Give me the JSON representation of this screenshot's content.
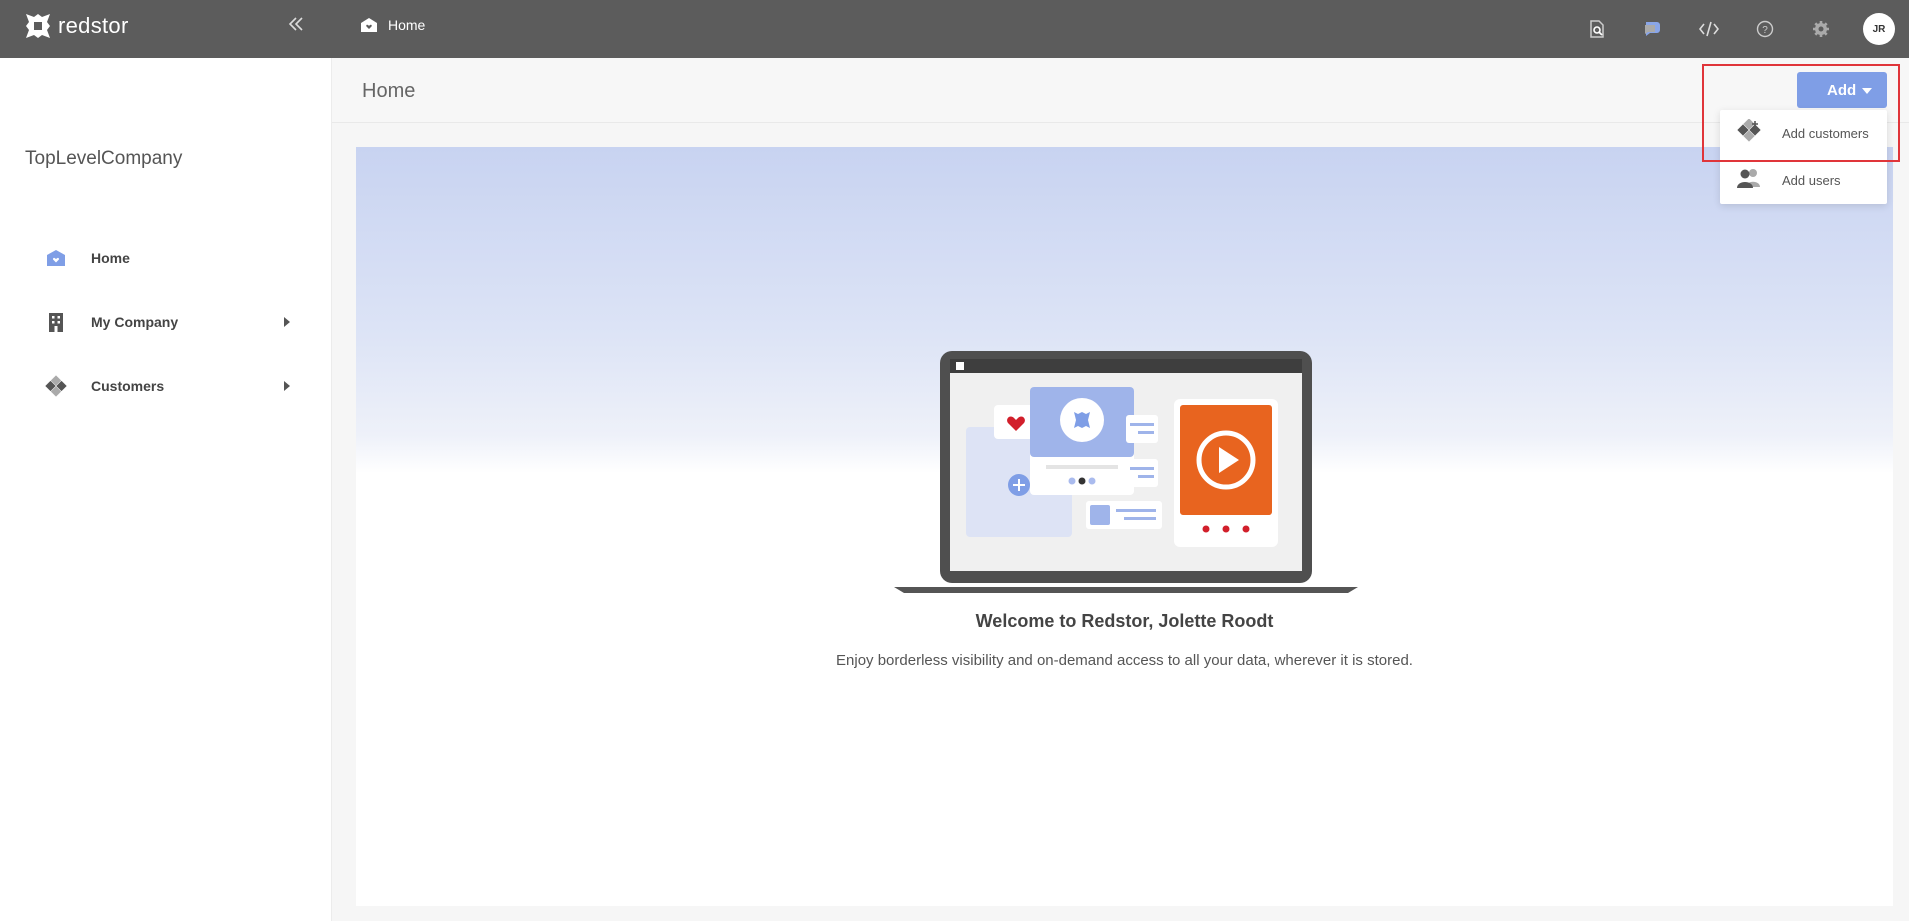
{
  "app": {
    "logo_text": "redstor"
  },
  "topbar": {
    "breadcrumb": "Home",
    "icons": [
      "search-document-icon",
      "chat-icon",
      "code-icon",
      "help-icon",
      "gear-icon"
    ],
    "avatar_initials": "JR"
  },
  "sidebar": {
    "company": "TopLevelCompany",
    "items": [
      {
        "label": "Home",
        "icon": "home-icon",
        "expandable": false
      },
      {
        "label": "My Company",
        "icon": "building-icon",
        "expandable": true
      },
      {
        "label": "Customers",
        "icon": "customers-icon",
        "expandable": true
      }
    ]
  },
  "page": {
    "title": "Home"
  },
  "add_menu": {
    "button_label": "Add",
    "items": [
      {
        "label": "Add customers",
        "icon": "add-customers-icon"
      },
      {
        "label": "Add users",
        "icon": "add-users-icon"
      }
    ]
  },
  "welcome": {
    "heading": "Welcome to Redstor, Jolette Roodt",
    "subtext": "Enjoy borderless visibility and on-demand access to all your data, wherever it is stored."
  },
  "colors": {
    "topbar": "#5c5c5c",
    "accent": "#7f9ee6",
    "highlight": "#e0353a",
    "video_orange": "#e8641f",
    "heart_red": "#d21f2b"
  }
}
